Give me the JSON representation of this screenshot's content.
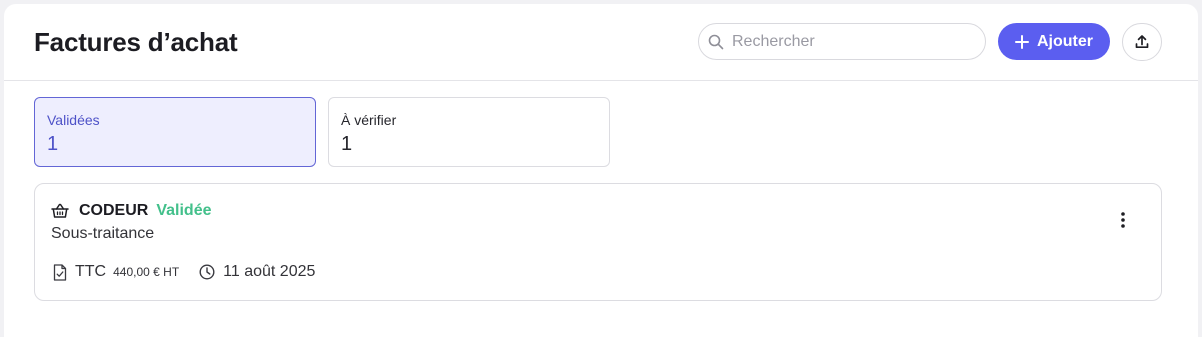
{
  "header": {
    "title": "Factures d’achat",
    "search_placeholder": "Rechercher",
    "add_label": "Ajouter"
  },
  "tiles": [
    {
      "label": "Validées",
      "count": "1",
      "selected": true
    },
    {
      "label": "À vérifier",
      "count": "1",
      "selected": false
    }
  ],
  "invoice": {
    "supplier": "CODEUR",
    "status": "Validée",
    "category": "Sous-traitance",
    "ttc_label": "TTC",
    "amount": "440,00 € HT",
    "date": "11 août 2025"
  },
  "colors": {
    "accent": "#5b5ef0",
    "status_validated": "#43c08b",
    "tile_selected_bg": "#eeeefe"
  },
  "icons": {
    "search": "search-icon",
    "add": "plus-icon",
    "export": "upload-icon",
    "supplier": "basket-icon",
    "document": "document-check-icon",
    "date": "clock-icon",
    "menu": "more-vertical-icon"
  }
}
